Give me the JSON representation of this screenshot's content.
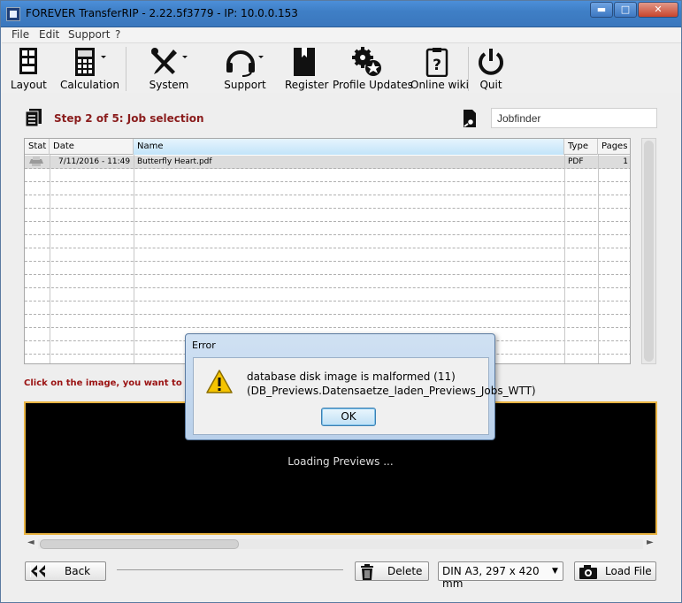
{
  "window": {
    "title": "FOREVER TransferRIP - 2.22.5f3779 - IP: 10.0.0.153",
    "controls": {
      "minimize": "▬",
      "maximize": "□",
      "close": "✕"
    }
  },
  "menu": [
    "File",
    "Edit",
    "Support",
    "?"
  ],
  "toolbar": [
    {
      "label": "Layout",
      "icon": "layout-icon"
    },
    {
      "label": "Calculation",
      "icon": "calculator-icon"
    },
    {
      "label": "System",
      "icon": "tools-icon"
    },
    {
      "label": "Support",
      "icon": "headset-icon"
    },
    {
      "label": "Register",
      "icon": "book-icon"
    },
    {
      "label": "Profile Updates",
      "icon": "gears-icon"
    },
    {
      "label": "Online wiki",
      "icon": "clipboard-question-icon"
    },
    {
      "label": "Quit",
      "icon": "power-icon"
    }
  ],
  "step": {
    "text": "Step 2 of 5: Job selection",
    "color": "#8a1c1c"
  },
  "jobfinder": {
    "placeholder": "Jobfinder"
  },
  "table": {
    "columns": [
      "Stat",
      "Date",
      "Name",
      "Type",
      "Pages"
    ],
    "rows": [
      {
        "date": "7/11/2016 - 11:49",
        "name": "Butterfly Heart.pdf",
        "type": "PDF",
        "pages": "1"
      }
    ]
  },
  "hint": "Click on the image, you want to edit",
  "preview": {
    "status": "Loading Previews ..."
  },
  "bottom": {
    "back": "Back",
    "delete": "Delete",
    "paper_size": "DIN A3, 297 x 420 mm",
    "load_file": "Load File"
  },
  "dialog": {
    "title": "Error",
    "line1": "database disk image is malformed (11)",
    "line2": "(DB_Previews.Datensaetze_laden_Previews_Jobs_WTT)",
    "ok": "OK"
  },
  "colors": {
    "accent_border": "#e9b443",
    "hint": "#9a1212",
    "titlebar": "#3f7fc6"
  }
}
